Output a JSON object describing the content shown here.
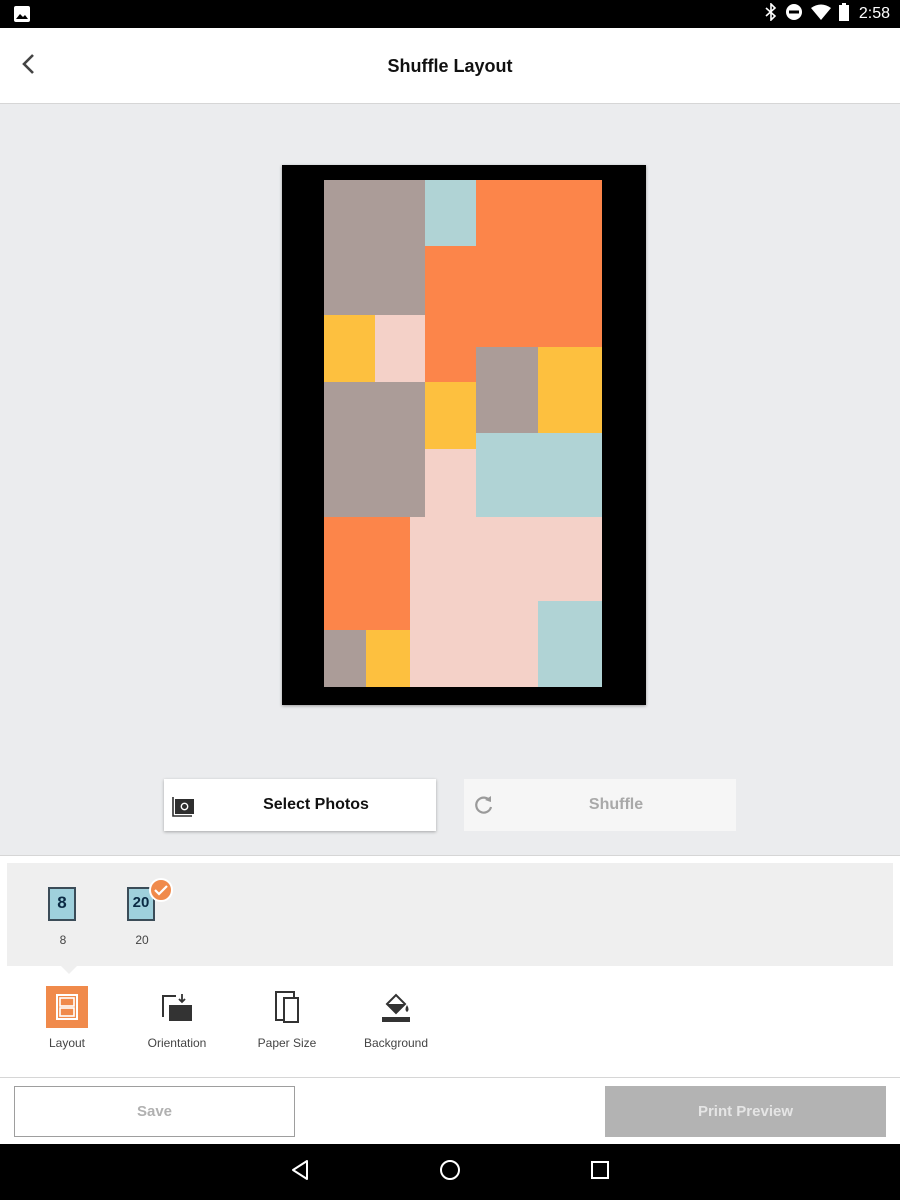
{
  "status_bar": {
    "time": "2:58",
    "icons": [
      "image-icon",
      "bluetooth-icon",
      "do-not-disturb-icon",
      "wifi-icon",
      "battery-icon"
    ]
  },
  "app_bar": {
    "title": "Shuffle Layout",
    "back_icon": "back-arrow-icon"
  },
  "collage": {
    "background_color": "#000000",
    "palette": {
      "taupe": "#ab9c98",
      "light_blue": "#b0d3d5",
      "orange": "#fc854a",
      "yellow": "#fdc03f",
      "pink": "#f4d1c8"
    },
    "cells": [
      "taupe",
      "light_blue",
      "orange",
      "orange",
      "yellow",
      "pink",
      "orange",
      "taupe",
      "yellow",
      "taupe",
      "yellow",
      "pink",
      "light_blue",
      "light_blue",
      "orange",
      "pink",
      "pink",
      "light_blue",
      "taupe",
      "yellow"
    ]
  },
  "actions": {
    "select_photos": "Select Photos",
    "shuffle": "Shuffle"
  },
  "layout_options": [
    {
      "label": "8",
      "thumb_text": "8",
      "selected": false
    },
    {
      "label": "20",
      "thumb_text": "20",
      "selected": true
    }
  ],
  "toolbar": [
    {
      "label": "Layout",
      "icon": "layout-icon",
      "active": true
    },
    {
      "label": "Orientation",
      "icon": "orientation-icon",
      "active": false
    },
    {
      "label": "Paper Size",
      "icon": "paper-size-icon",
      "active": false
    },
    {
      "label": "Background",
      "icon": "paint-bucket-icon",
      "active": false
    }
  ],
  "footer": {
    "save": "Save",
    "print_preview": "Print Preview"
  },
  "nav_bar": [
    "back-triangle-icon",
    "home-circle-icon",
    "recents-square-icon"
  ],
  "colors": {
    "accent": "#f08a4b",
    "disabled_text": "#b1b1b1",
    "disabled_button": "#b3b3b3"
  }
}
